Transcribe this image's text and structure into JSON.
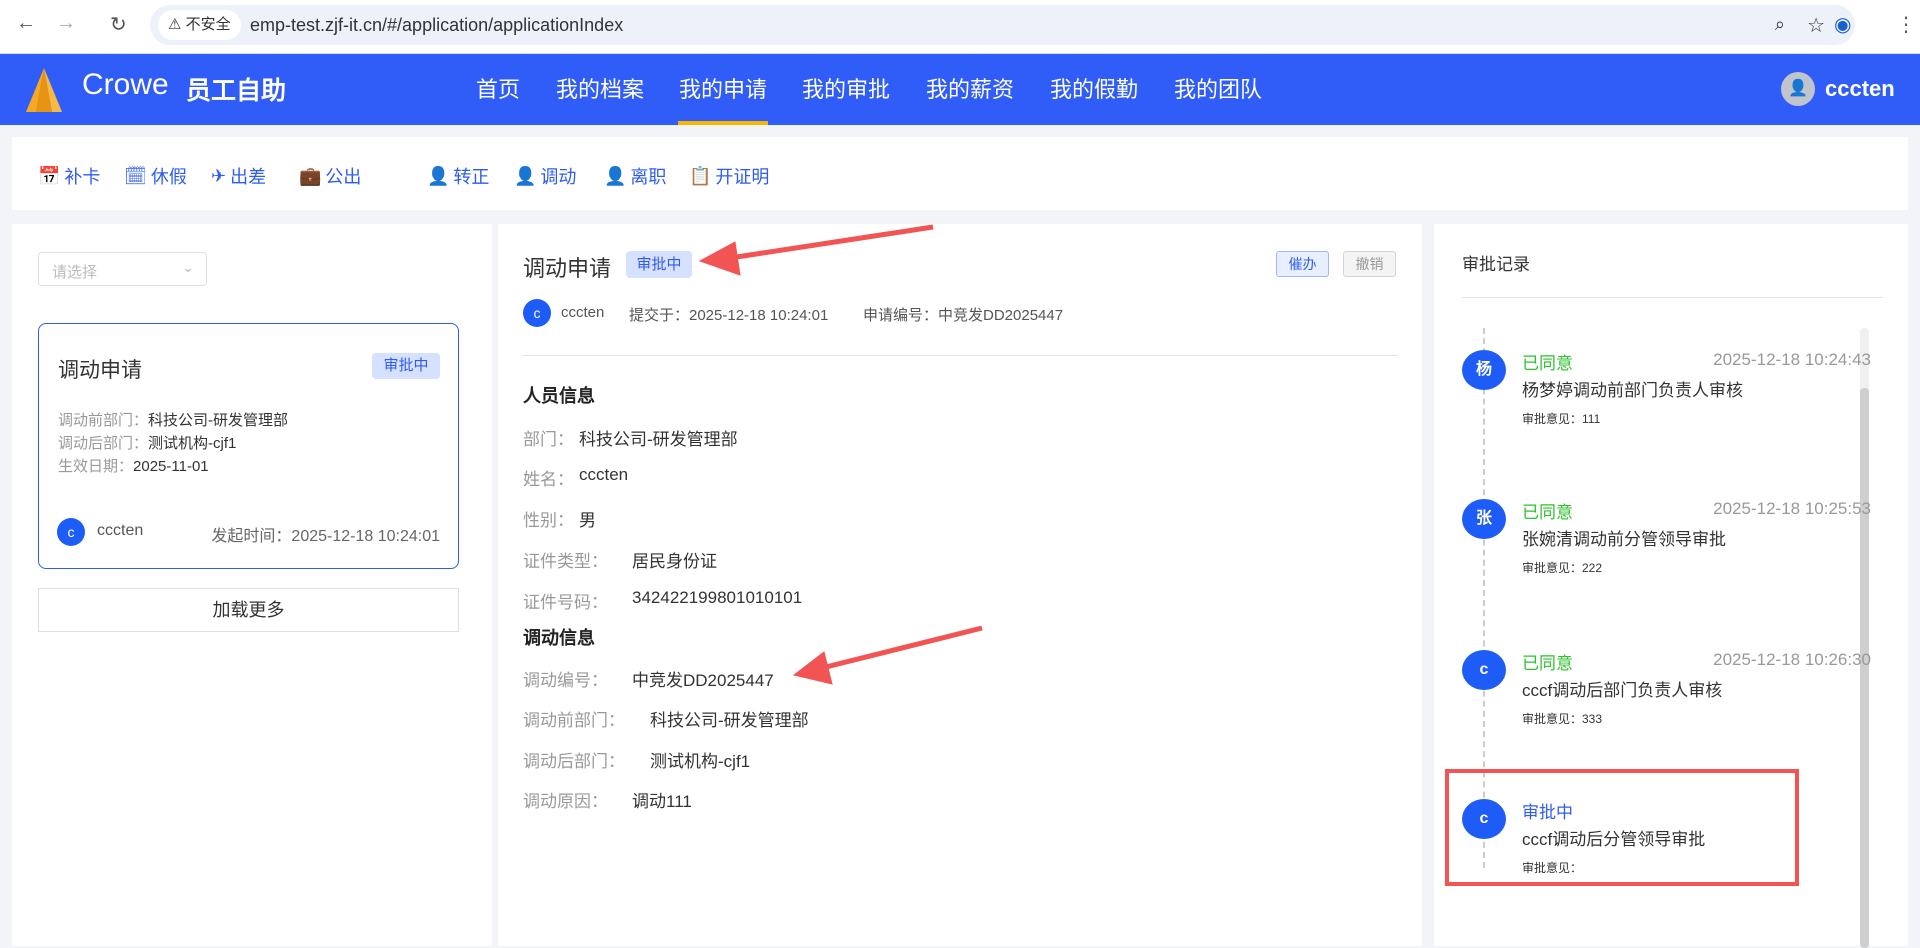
{
  "browser": {
    "insecure_label": "不安全",
    "url": "emp-test.zjf-it.cn/#/application/applicationIndex"
  },
  "header": {
    "brand": "Crowe",
    "app_name": "员工自助",
    "nav": [
      "首页",
      "我的档案",
      "我的申请",
      "我的审批",
      "我的薪资",
      "我的假勤",
      "我的团队"
    ],
    "active_nav": "我的申请",
    "user": "cccten"
  },
  "toolbar": {
    "items": [
      "补卡",
      "休假",
      "出差",
      "公出",
      "转正",
      "调动",
      "离职",
      "开证明"
    ]
  },
  "left": {
    "select_placeholder": "请选择",
    "card": {
      "title": "调动申请",
      "status": "审批中",
      "fields": [
        {
          "label": "调动前部门：",
          "value": "科技公司-研发管理部"
        },
        {
          "label": "调动后部门：",
          "value": "测试机构-cjf1"
        },
        {
          "label": "生效日期：",
          "value": "2025-11-01"
        }
      ],
      "avatar": "c",
      "user": "cccten",
      "time_label": "发起时间：",
      "time": "2025-12-18 10:24:01"
    },
    "load_more": "加载更多"
  },
  "detail": {
    "title": "调动申请",
    "status": "审批中",
    "urge": "催办",
    "revoke": "撤销",
    "avatar": "c",
    "user": "cccten",
    "submitted": "提交于：2025-12-18 10:24:01",
    "app_no": "申请编号：中竞发DD2025447",
    "person_section": "人员信息",
    "person": [
      {
        "label": "部门：",
        "value": "科技公司-研发管理部"
      },
      {
        "label": "姓名：",
        "value": "cccten"
      },
      {
        "label": "性别：",
        "value": "男"
      },
      {
        "label": "证件类型：",
        "value": "居民身份证"
      },
      {
        "label": "证件号码：",
        "value": "342422199801010101"
      }
    ],
    "transfer_section": "调动信息",
    "transfer": [
      {
        "label": "调动编号：",
        "value": "中竞发DD2025447"
      },
      {
        "label": "调动前部门：",
        "value": "科技公司-研发管理部"
      },
      {
        "label": "调动后部门：",
        "value": "测试机构-cjf1"
      },
      {
        "label": "调动原因：",
        "value": "调动111"
      }
    ]
  },
  "records": {
    "title": "审批记录",
    "items": [
      {
        "avatar": "杨",
        "status": "已同意",
        "time": "2025-12-18 10:24:43",
        "step": "杨梦婷调动前部门负责人审核",
        "comment": "审批意见：111"
      },
      {
        "avatar": "张",
        "status": "已同意",
        "time": "2025-12-18 10:25:53",
        "step": "张婉清调动前分管领导审批",
        "comment": "审批意见：222"
      },
      {
        "avatar": "c",
        "status": "已同意",
        "time": "2025-12-18 10:26:30",
        "step": "cccf调动后部门负责人审核",
        "comment": "审批意见：333"
      },
      {
        "avatar": "c",
        "status": "审批中",
        "time": "",
        "step": "cccf调动后分管领导审批",
        "comment": "审批意见："
      }
    ]
  },
  "colors": {
    "brand": "#305cf8",
    "approved": "#2ec22e",
    "pending": "#2f5cf0",
    "annotation": "#f25454"
  }
}
